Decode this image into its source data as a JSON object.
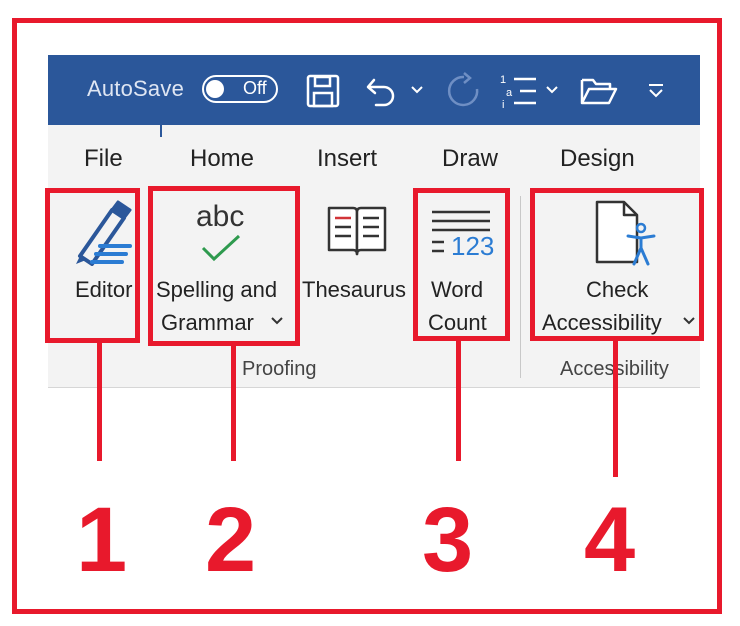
{
  "quick_access": {
    "autosave_label": "AutoSave",
    "autosave_state": "Off",
    "icons": [
      "save-icon",
      "undo-icon",
      "redo-icon",
      "numbering-icon",
      "open-folder-icon",
      "customize-toolbar-icon"
    ]
  },
  "tabs": [
    "File",
    "Home",
    "Insert",
    "Draw",
    "Design"
  ],
  "ribbon": {
    "editor": {
      "label": "Editor"
    },
    "spelling": {
      "line1": "Spelling and",
      "line2": "Grammar",
      "icon_text": "abc"
    },
    "thesaurus": {
      "label": "Thesaurus"
    },
    "word_count": {
      "line1": "Word",
      "line2": "Count",
      "icon_text": "123"
    },
    "accessibility": {
      "line1": "Check",
      "line2": "Accessibility"
    },
    "groups": {
      "proofing": "Proofing",
      "accessibility": "Accessibility"
    }
  },
  "callouts": [
    "1",
    "2",
    "3",
    "4"
  ],
  "colors": {
    "titlebar": "#2b579a",
    "ribbon": "#f3f3f3",
    "callout_red": "#e8192c",
    "accent_blue": "#2b7cd3"
  }
}
